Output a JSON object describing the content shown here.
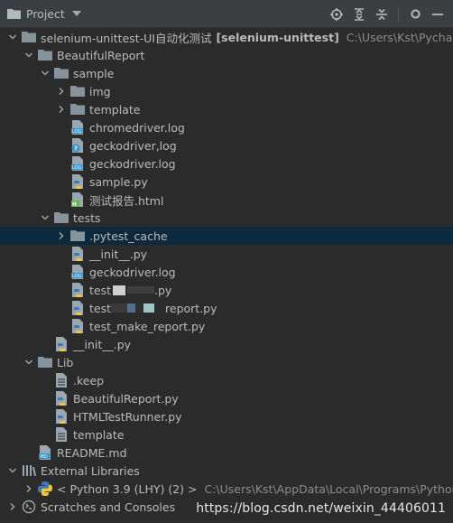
{
  "toolbar": {
    "title": "Project"
  },
  "tree": {
    "root": {
      "name": "selenium-unittest-UI自动化测试",
      "module": "[selenium-unittest]",
      "path": "C:\\Users\\Kst\\PycharmProj"
    },
    "items": [
      {
        "name": "BeautifulReport"
      },
      {
        "name": "sample"
      },
      {
        "name": "img"
      },
      {
        "name": "template"
      },
      {
        "name": "chromedriver.log"
      },
      {
        "name": "geckodriver,log"
      },
      {
        "name": "geckodriver.log"
      },
      {
        "name": "sample.py"
      },
      {
        "name": "测试报告.html"
      },
      {
        "name": "tests"
      },
      {
        "name": ".pytest_cache"
      },
      {
        "name": "__init__.py"
      },
      {
        "name": "geckodriver.log"
      },
      {
        "name_a": "test",
        "name_b": ".py"
      },
      {
        "name_a": "test",
        "name_b": "report.py"
      },
      {
        "name": "test_make_report.py"
      },
      {
        "name": "__init__.py"
      },
      {
        "name": "Lib"
      },
      {
        "name": ".keep"
      },
      {
        "name": "BeautifulReport.py"
      },
      {
        "name": "HTMLTestRunner.py"
      },
      {
        "name": "template"
      },
      {
        "name": "README.md"
      },
      {
        "name": "External Libraries"
      },
      {
        "name": "< Python 3.9 (LHY) (2) >",
        "path": "C:\\Users\\Kst\\AppData\\Local\\Programs\\Python\\Pyt"
      },
      {
        "name": "Scratches and Consoles"
      }
    ]
  },
  "watermark": "https://blog.csdn.net/weixin_44406011"
}
